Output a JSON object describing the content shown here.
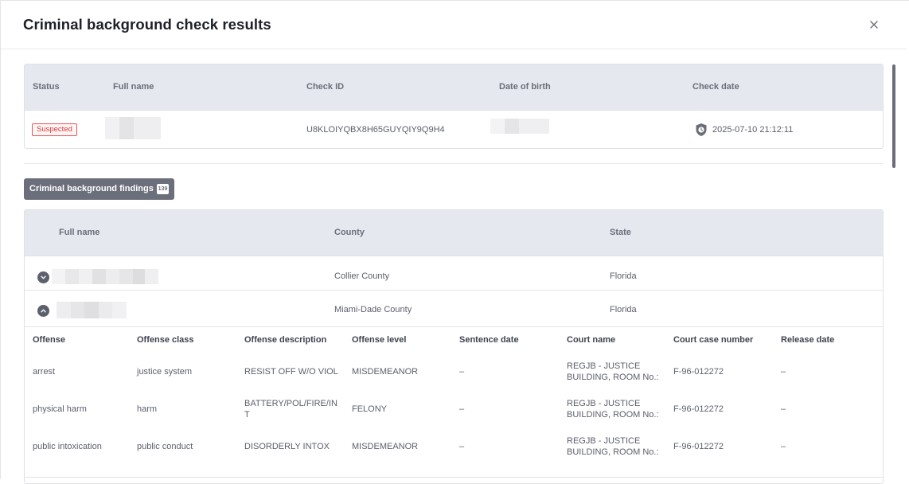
{
  "modal": {
    "title": "Criminal background check results",
    "close_icon": "close-icon"
  },
  "summary": {
    "headers": {
      "status": "Status",
      "full_name": "Full name",
      "check_id": "Check ID",
      "dob": "Date of birth",
      "check_date": "Check date"
    },
    "row": {
      "status": "Suspected",
      "full_name": "",
      "check_id": "U8KLOIYQBX8H65GUYQIY9Q9H4",
      "dob": "",
      "check_date": "2025-07-10 21:12:11",
      "check_date_icon": "shield-clock-icon"
    }
  },
  "findings_button": {
    "label": "Criminal background findings",
    "count": "139"
  },
  "findings": {
    "headers": {
      "full_name": "Full name",
      "county": "County",
      "state": "State"
    },
    "rows": [
      {
        "full_name": "",
        "county": "Collier County",
        "state": "Florida",
        "expanded": false
      },
      {
        "full_name": "",
        "county": "Miami-Dade County",
        "state": "Florida",
        "expanded": true
      }
    ]
  },
  "offenses": {
    "headers": {
      "offense": "Offense",
      "offense_class": "Offense class",
      "description": "Offense description",
      "level": "Offense level",
      "sentence_date": "Sentence date",
      "court_name": "Court name",
      "case_number": "Court case number",
      "release_date": "Release date"
    },
    "rows": [
      {
        "offense": "arrest",
        "offense_class": "justice system",
        "description": "RESIST OFF W/O VIOL",
        "level": "MISDEMEANOR",
        "sentence_date": "–",
        "court_name": "REGJB - JUSTICE BUILDING, ROOM No.:",
        "case_number": "F-96-012272",
        "release_date": "–"
      },
      {
        "offense": "physical harm",
        "offense_class": "harm",
        "description": "BATTERY/POL/FIRE/INT",
        "level": "FELONY",
        "sentence_date": "–",
        "court_name": "REGJB - JUSTICE BUILDING, ROOM No.:",
        "case_number": "F-96-012272",
        "release_date": "–"
      },
      {
        "offense": "public intoxication",
        "offense_class": "public conduct",
        "description": "DISORDERLY INTOX",
        "level": "MISDEMEANOR",
        "sentence_date": "–",
        "court_name": "REGJB - JUSTICE BUILDING, ROOM No.:",
        "case_number": "F-96-012272",
        "release_date": "–"
      }
    ]
  },
  "colors": {
    "header_bg": "#e6e8ef",
    "button_bg": "#6b6f7c",
    "suspected": "#d83a3c"
  }
}
